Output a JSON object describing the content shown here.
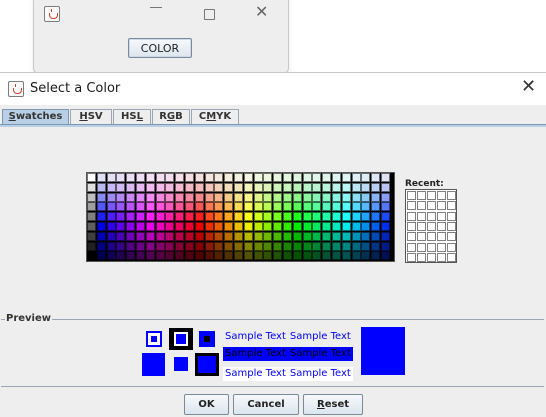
{
  "parent_window": {
    "button_label": "COLOR"
  },
  "dialog": {
    "title": "Select a Color",
    "tabs": [
      {
        "label": "Swatches",
        "mnemonic_index": 0,
        "active": true
      },
      {
        "label": "HSV",
        "mnemonic_index": 0,
        "active": false
      },
      {
        "label": "HSL",
        "mnemonic_index": 2,
        "active": false
      },
      {
        "label": "RGB",
        "mnemonic_index": 1,
        "active": false
      },
      {
        "label": "CMYK",
        "mnemonic_index": 1,
        "active": false
      }
    ],
    "recent_label": "Recent:",
    "preview_label": "Preview",
    "sample_text": "Sample Text",
    "selected_color": "#0000ff",
    "buttons": {
      "ok": "OK",
      "cancel": "Cancel",
      "reset": "Reset"
    }
  },
  "icons": [
    "java-app-icon",
    "minimize-icon",
    "maximize-icon",
    "close-icon"
  ],
  "colors": {
    "tab_active": "#b8cfe5",
    "sample_fg": "#0000ff",
    "sample_highlight_bg": "#0000ff",
    "dialog_bg": "#eeeeee"
  }
}
